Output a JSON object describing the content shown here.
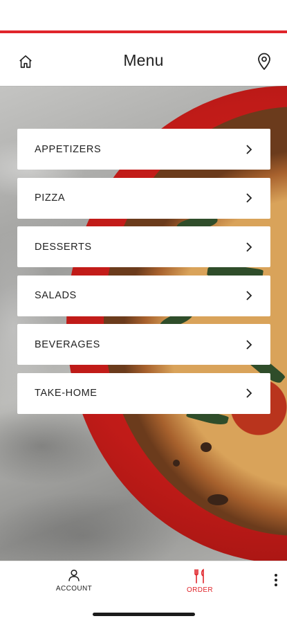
{
  "header": {
    "title": "Menu",
    "home_icon": "home-icon",
    "location_icon": "location-pin-icon"
  },
  "menu": {
    "items": [
      {
        "label": "APPETIZERS"
      },
      {
        "label": "PIZZA"
      },
      {
        "label": "DESSERTS"
      },
      {
        "label": "SALADS"
      },
      {
        "label": "BEVERAGES"
      },
      {
        "label": "TAKE-HOME"
      }
    ]
  },
  "bottom_nav": {
    "tabs": [
      {
        "label": "ACCOUNT",
        "icon": "person-icon",
        "active": false
      },
      {
        "label": "ORDER",
        "icon": "utensils-icon",
        "active": true
      }
    ],
    "more_icon": "more-vertical-icon"
  },
  "colors": {
    "accent": "#e0252b",
    "text": "#222222",
    "card": "#ffffff"
  }
}
